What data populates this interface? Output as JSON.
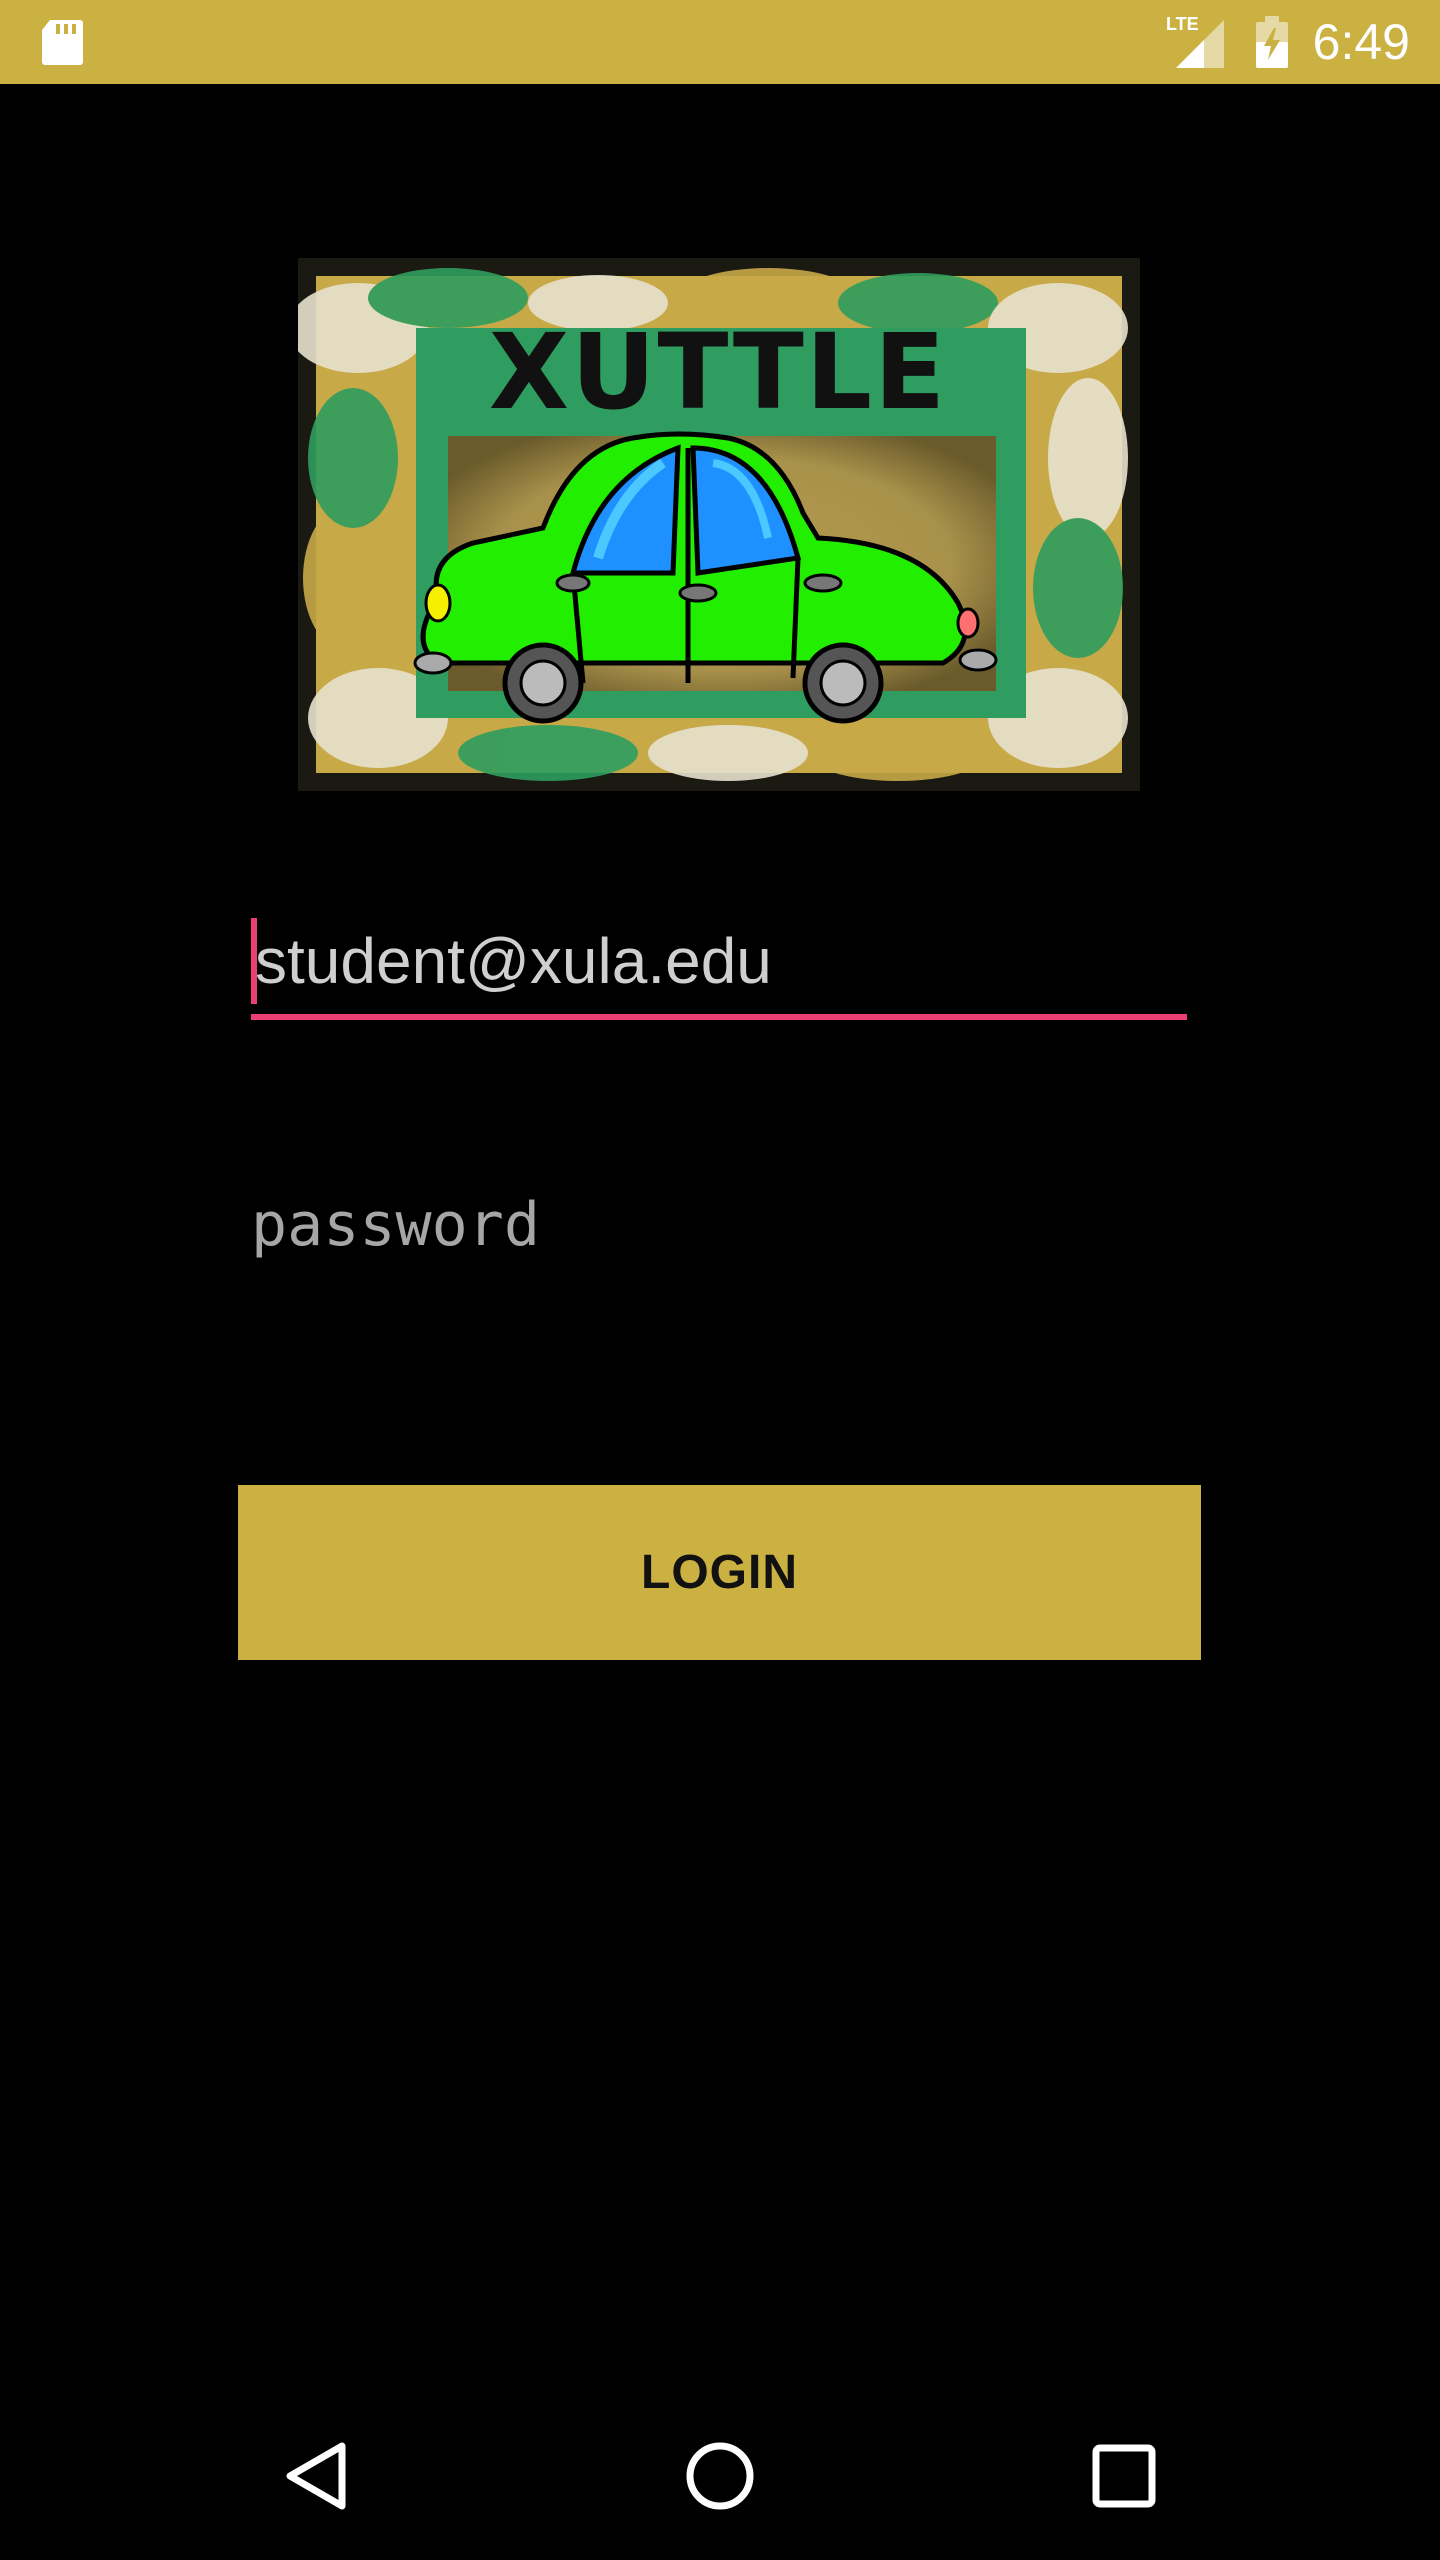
{
  "status_bar": {
    "time": "6:49",
    "network_label": "LTE",
    "color": "#cbb042",
    "icons": [
      "sd-card-icon",
      "lte-signal-icon",
      "battery-charging-icon"
    ]
  },
  "logo": {
    "text": "XUTTLE",
    "colors": {
      "car_body": "#22ee00",
      "windows": "#1e90ff",
      "frame_gold": "#c8a948",
      "frame_green": "#2e9d5f"
    }
  },
  "login_form": {
    "email_value": "student@xula.edu",
    "password_placeholder": "password",
    "login_label": "LOGIN",
    "accent_color": "#ea3f72",
    "button_color": "#cbb042"
  },
  "nav_bar": {
    "icons": [
      "back-icon",
      "home-icon",
      "recents-icon"
    ]
  }
}
